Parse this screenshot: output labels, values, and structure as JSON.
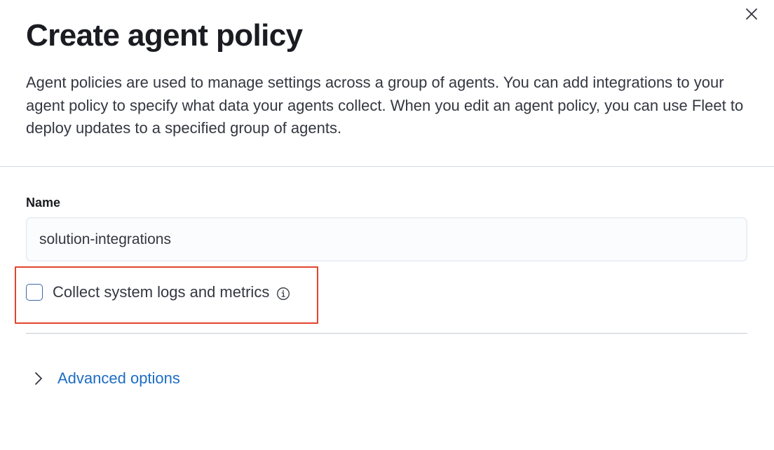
{
  "flyout": {
    "title": "Create agent policy",
    "description": "Agent policies are used to manage settings across a group of agents. You can add integrations to your agent policy to specify what data your agents collect. When you edit an agent policy, you can use Fleet to deploy updates to a specified group of agents.",
    "close_icon": "close-icon"
  },
  "form": {
    "name_label": "Name",
    "name_value": "solution-integrations",
    "collect_system_label": "Collect system logs and metrics",
    "collect_system_checked": false,
    "info_icon": "info-circle-icon",
    "advanced_options_label": "Advanced options",
    "advanced_icon": "chevron-right-icon"
  },
  "colors": {
    "highlight_border": "#e2452b",
    "link": "#1d6dc4",
    "checkbox_border": "#3c67a8"
  }
}
